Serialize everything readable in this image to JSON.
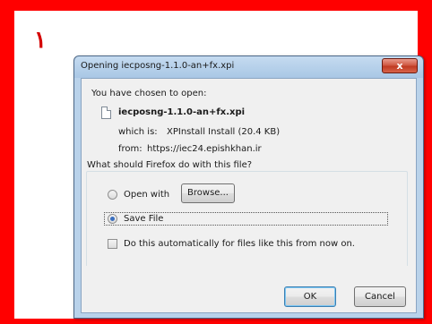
{
  "step_number": "١",
  "dialog": {
    "title": "Opening iecposng-1.1.0-an+fx.xpi",
    "close_glyph": "x",
    "chosen_label": "You have chosen to open:",
    "filename": "iecposng-1.1.0-an+fx.xpi",
    "which_is_label": "which is:",
    "which_is_value": "XPInstall Install (20.4 KB)",
    "from_label": "from:",
    "from_value": "https://iec24.epishkhan.ir",
    "question": "What should Firefox do with this file?",
    "open_with_label": "Open with",
    "browse_label": "Browse...",
    "save_file_label": "Save File",
    "save_file_selected": true,
    "auto_label": "Do this automatically for files like this from now on.",
    "auto_checked": false,
    "ok_label": "OK",
    "cancel_label": "Cancel"
  },
  "colors": {
    "frame": "#ff0000",
    "step_number": "#d40000",
    "close_button": "#c83c26"
  }
}
